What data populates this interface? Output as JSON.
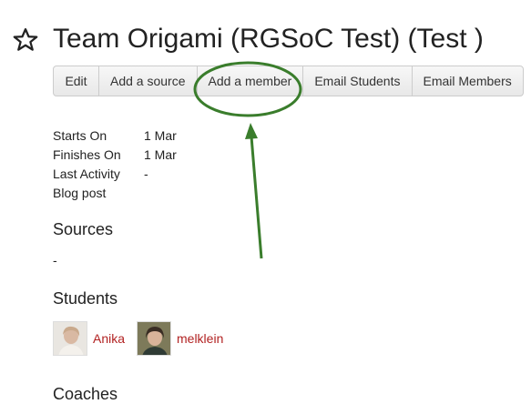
{
  "header": {
    "title": "Team Origami (RGSoC Test) (Test )"
  },
  "toolbar": {
    "buttons": [
      {
        "label": "Edit"
      },
      {
        "label": "Add a source"
      },
      {
        "label": "Add a member"
      },
      {
        "label": "Email Students"
      },
      {
        "label": "Email Members"
      }
    ]
  },
  "details": {
    "rows": [
      {
        "label": "Starts On",
        "value": "1 Mar"
      },
      {
        "label": "Finishes On",
        "value": "1 Mar"
      },
      {
        "label": "Last Activity",
        "value": "-"
      },
      {
        "label": "Blog post",
        "value": ""
      }
    ]
  },
  "sources": {
    "heading": "Sources",
    "empty_text": "-"
  },
  "students": {
    "heading": "Students",
    "items": [
      {
        "name": "Anika"
      },
      {
        "name": "melklein"
      }
    ]
  },
  "coaches": {
    "heading": "Coaches"
  },
  "colors": {
    "link": "#b22222",
    "annotation": "#3a7d2c"
  },
  "icons": {
    "favorite": "star-outline-icon"
  }
}
